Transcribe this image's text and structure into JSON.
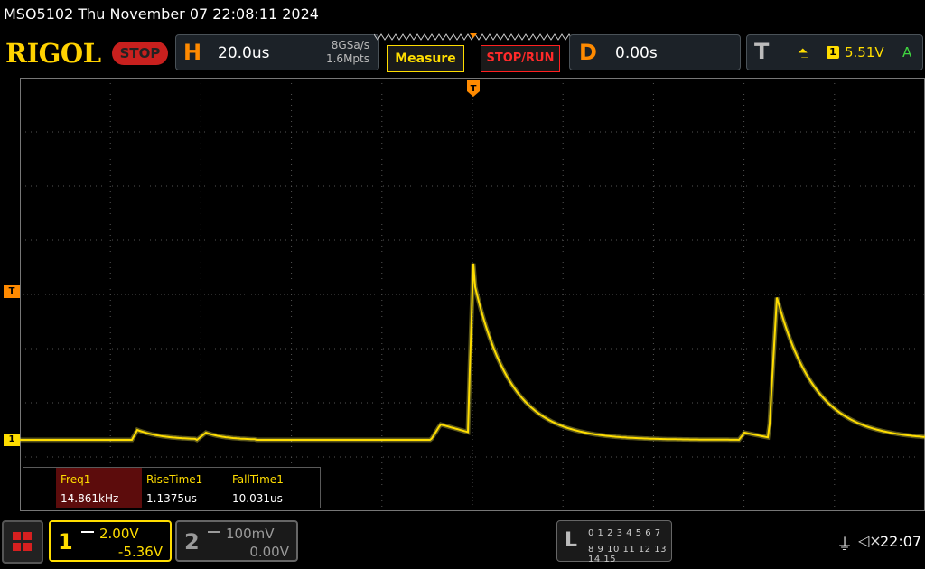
{
  "status_bar": {
    "text": "MSO5102  Thu November 07 22:08:11 2024"
  },
  "header": {
    "logo": "RIGOL",
    "run_state": "STOP",
    "horizontal": {
      "key": "H",
      "timebase": "20.0us",
      "sample_rate": "8GSa/s",
      "memory_depth": "1.6Mpts"
    },
    "measure_button": "Measure",
    "stop_run_button": "STOP/RUN",
    "delay": {
      "key": "D",
      "value": "0.00s"
    },
    "trigger": {
      "key": "T",
      "edge": "rising-edge-icon",
      "source": "1",
      "level": "5.51V",
      "mode": "A"
    }
  },
  "markers": {
    "trigger_position": "T",
    "trigger_level": "T",
    "ch1_ground": "1"
  },
  "measurements": [
    {
      "label": "Freq1",
      "value": "14.861kHz"
    },
    {
      "label": "RiseTime1",
      "value": "1.1375us"
    },
    {
      "label": "FallTime1",
      "value": "10.031us"
    }
  ],
  "channels": [
    {
      "number": "1",
      "scale": "2.00V",
      "offset": "-5.36V",
      "color": "#ffdd00",
      "active": true
    },
    {
      "number": "2",
      "scale": "100mV",
      "offset": "0.00V",
      "color": "#9a9a9a",
      "active": false
    }
  ],
  "logic_analyzer": {
    "key": "L",
    "row1": "0 1 2 3  4 5 6 7",
    "row2": "8 9 10 11 12 13 14 15"
  },
  "system": {
    "usb": "usb-icon",
    "sound": "speaker-mute-icon",
    "time": "22:07"
  },
  "colors": {
    "accent": "#ff8a00",
    "ch1": "#ffdd00",
    "stop": "#c8201e"
  }
}
